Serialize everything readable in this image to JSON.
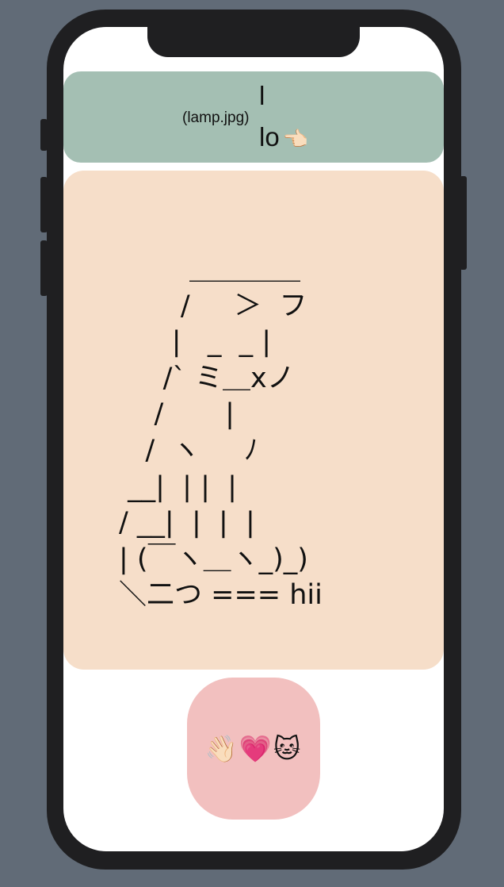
{
  "header": {
    "image_alt": "(lamp.jpg)",
    "line1": "l",
    "line2": "lo",
    "line2_emoji": "👈🏻"
  },
  "art": {
    "text": "        ＿＿＿＿\n       /     ＞  フ\n      |   _  _ |\n     /` ミ＿xノ\n    /       |\n   /  ヽ     ﾉ\n __|  | |  |\n/ __|  |  |  |\n| (￣ヽ＿ヽ_)_)\n＼二つ === hii"
  },
  "emoji_button": {
    "label": "👋🏻💗🐱"
  },
  "colors": {
    "background": "#616b77",
    "header_card": "#a4bfb3",
    "art_card": "#f6dec9",
    "emoji_button": "#f2c0bf"
  }
}
